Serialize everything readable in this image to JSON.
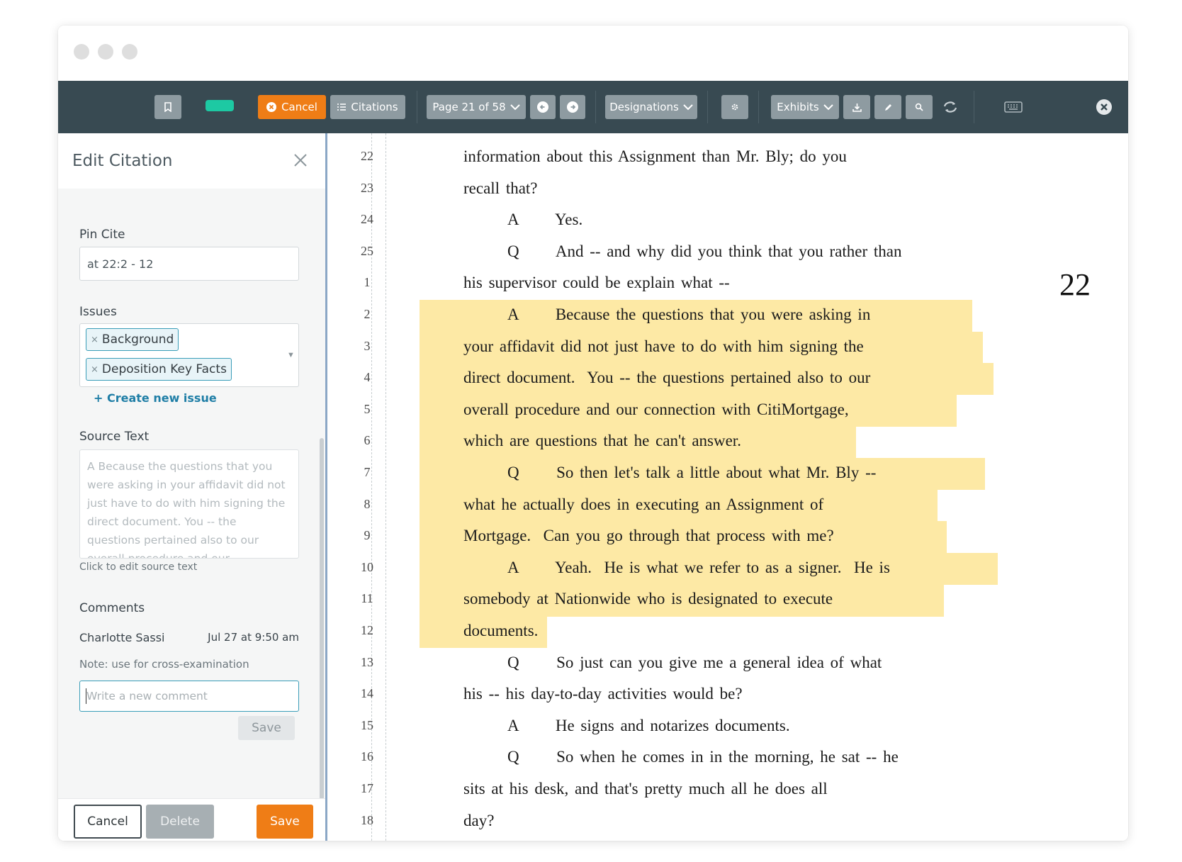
{
  "toolbar": {
    "cancel_label": "Cancel",
    "citations_label": "Citations",
    "page_label": "Page 21 of 58",
    "designations_label": "Designations",
    "exhibits_label": "Exhibits",
    "highlight_color": "#1dc9a3",
    "accent_color": "#ef7d16"
  },
  "sidebar": {
    "title": "Edit Citation",
    "pin_cite_label": "Pin Cite",
    "pin_cite_value": "at 22:2 - 12",
    "issues_label": "Issues",
    "issues": [
      "Background",
      "Deposition Key Facts"
    ],
    "create_issue_label": "+ Create new issue",
    "source_text_label": "Source Text",
    "source_text": "A Because the questions that you were asking in your affidavit did not just have to do with him signing the direct document. You -- the questions pertained also to our overall procedure and our",
    "source_hint": "Click to edit source text",
    "comments_label": "Comments",
    "comment_author": "Charlotte Sassi",
    "comment_date": "Jul 27 at 9:50 am",
    "comment_text": "Note: use for cross-examination",
    "new_comment_placeholder": "Write a new comment",
    "comment_save_label": "Save",
    "footer_cancel": "Cancel",
    "footer_delete": "Delete",
    "footer_save": "Save"
  },
  "transcript": {
    "page_number": "22",
    "lines": [
      {
        "num": "22",
        "text": "information about this Assignment than Mr. Bly; do you"
      },
      {
        "num": "23",
        "text": "recall that?"
      },
      {
        "num": "24",
        "text": "A      Yes."
      },
      {
        "num": "25",
        "text": "Q      And -- and why did you think that you rather than"
      },
      {
        "num": "1",
        "text": "his supervisor could be explain what --"
      },
      {
        "num": "2",
        "text": "A      Because the questions that you were asking in"
      },
      {
        "num": "3",
        "text": "your affidavit did not just have to do with him signing the"
      },
      {
        "num": "4",
        "text": "direct document.  You -- the questions pertained also to our"
      },
      {
        "num": "5",
        "text": "overall procedure and our connection with CitiMortgage,"
      },
      {
        "num": "6",
        "text": "which are questions that he can't answer."
      },
      {
        "num": "7",
        "text": "Q      So then let's talk a little about what Mr. Bly --"
      },
      {
        "num": "8",
        "text": "what he actually does in executing an Assignment of"
      },
      {
        "num": "9",
        "text": "Mortgage.  Can you go through that process with me?"
      },
      {
        "num": "10",
        "text": "A      Yeah.  He is what we refer to as a signer.  He is"
      },
      {
        "num": "11",
        "text": "somebody at Nationwide who is designated to execute"
      },
      {
        "num": "12",
        "text": "documents."
      },
      {
        "num": "13",
        "text": "Q      So just can you give me a general idea of what"
      },
      {
        "num": "14",
        "text": "his -- his day-to-day activities would be?"
      },
      {
        "num": "15",
        "text": "A      He signs and notarizes documents."
      },
      {
        "num": "16",
        "text": "Q      So when he comes in in the morning, he sat -- he"
      },
      {
        "num": "17",
        "text": "sits at his desk, and that's pretty much all he does all"
      },
      {
        "num": "18",
        "text": "day?"
      }
    ]
  }
}
